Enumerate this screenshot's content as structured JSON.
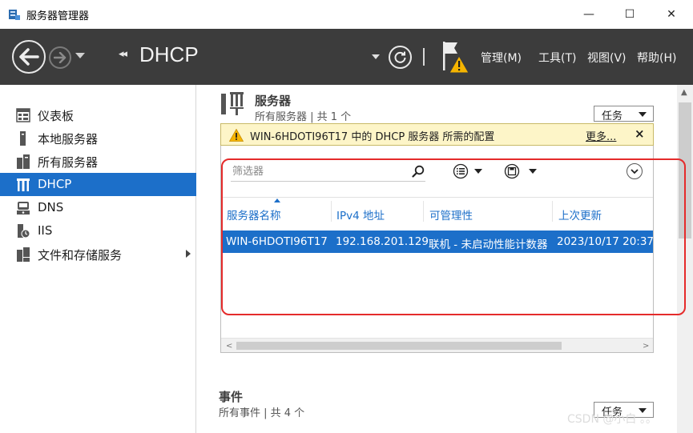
{
  "window": {
    "title": "服务器管理器",
    "minimize": "—",
    "maximize": "☐",
    "close": "✕"
  },
  "header": {
    "breadcrumb_arrows": "◂◂",
    "title": "DHCP",
    "menus": [
      "管理(M)",
      "工具(T)",
      "视图(V)",
      "帮助(H)"
    ]
  },
  "sidebar": {
    "items": [
      {
        "label": "仪表板",
        "icon": "dashboard-icon"
      },
      {
        "label": "本地服务器",
        "icon": "local-server-icon"
      },
      {
        "label": "所有服务器",
        "icon": "all-servers-icon"
      },
      {
        "label": "DHCP",
        "icon": "dhcp-icon",
        "active": true
      },
      {
        "label": "DNS",
        "icon": "dns-icon"
      },
      {
        "label": "IIS",
        "icon": "iis-icon"
      },
      {
        "label": "文件和存储服务",
        "icon": "file-storage-icon",
        "has_submenu": true
      }
    ]
  },
  "servers": {
    "title": "服务器",
    "subtitle": "所有服务器 | 共 1 个",
    "tasks_label": "任务",
    "warning": {
      "text": "WIN-6HDOTI96T17 中的 DHCP 服务器 所需的配置",
      "more": "更多...",
      "close": "×"
    },
    "filter_placeholder": "筛选器",
    "columns": [
      "服务器名称",
      "IPv4 地址",
      "可管理性",
      "上次更新"
    ],
    "rows": [
      {
        "name": "WIN-6HDOTI96T17",
        "ipv4": "192.168.201.129",
        "manageability": "联机 - 未启动性能计数器",
        "last_update": "2023/10/17 20:37:"
      }
    ]
  },
  "events": {
    "title": "事件",
    "subtitle": "所有事件 | 共 4 个",
    "tasks_label": "任务"
  },
  "watermark": "CSDN @小白 。。",
  "colors": {
    "header_bg": "#3c3c3c",
    "accent": "#1c6fc9",
    "warning_bg": "#fdf5c8",
    "highlight_outline": "#e52b2b"
  }
}
